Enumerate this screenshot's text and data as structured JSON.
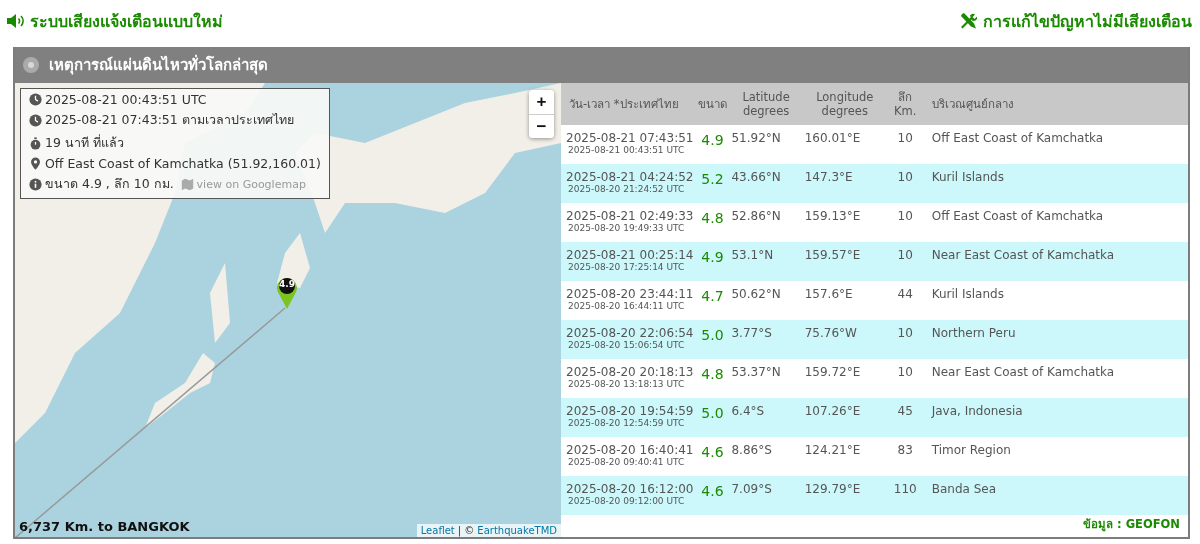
{
  "header": {
    "sound_link": "ระบบเสียงแจ้งเตือนแบบใหม่",
    "help_link": "การแก้ไขปัญหาไม่มีเสียงเตือน"
  },
  "panel": {
    "title": "เหตุการณ์แผ่นดินไหวทั่วโลกล่าสุด"
  },
  "map": {
    "info": [
      {
        "kind": "clock",
        "text": "2025-08-21 00:43:51 UTC"
      },
      {
        "kind": "clock",
        "text": "2025-08-21 07:43:51 ตามเวลาประเทศไทย"
      },
      {
        "kind": "stopwatch",
        "text": "19 นาที ที่แล้ว"
      },
      {
        "kind": "pin",
        "text": "Off East Coast of Kamchatka (51.92,160.01)"
      },
      {
        "kind": "info",
        "text": "ขนาด 4.9 , ลึก 10 กม.",
        "link": "view on Googlemap"
      }
    ],
    "zoom_in": "+",
    "zoom_out": "−",
    "marker": "4.9",
    "distance": "6,737 Km. to BANGKOK",
    "attribution": {
      "leaflet": "Leaflet",
      "separator": "| ©",
      "source": "EarthquakeTMD"
    }
  },
  "table": {
    "columns": [
      "วัน-เวลา *ประเทศไทย",
      "ขนาด",
      "Latitude\ndegrees",
      "Longitude\ndegrees",
      "ลึก\nKm.",
      "บริเวณศูนย์กลาง"
    ],
    "rows": [
      {
        "local": "2025-08-21 07:43:51",
        "utc": "2025-08-21 00:43:51 UTC",
        "mag": "4.9",
        "lat": "51.92°N",
        "lon": "160.01°E",
        "depth": "10",
        "region": "Off East Coast of Kamchatka"
      },
      {
        "local": "2025-08-21 04:24:52",
        "utc": "2025-08-20 21:24:52 UTC",
        "mag": "5.2",
        "lat": "43.66°N",
        "lon": "147.3°E",
        "depth": "10",
        "region": "Kuril Islands"
      },
      {
        "local": "2025-08-21 02:49:33",
        "utc": "2025-08-20 19:49:33 UTC",
        "mag": "4.8",
        "lat": "52.86°N",
        "lon": "159.13°E",
        "depth": "10",
        "region": "Off East Coast of Kamchatka"
      },
      {
        "local": "2025-08-21 00:25:14",
        "utc": "2025-08-20 17:25:14 UTC",
        "mag": "4.9",
        "lat": "53.1°N",
        "lon": "159.57°E",
        "depth": "10",
        "region": "Near East Coast of Kamchatka"
      },
      {
        "local": "2025-08-20 23:44:11",
        "utc": "2025-08-20 16:44:11 UTC",
        "mag": "4.7",
        "lat": "50.62°N",
        "lon": "157.6°E",
        "depth": "44",
        "region": "Kuril Islands"
      },
      {
        "local": "2025-08-20 22:06:54",
        "utc": "2025-08-20 15:06:54 UTC",
        "mag": "5.0",
        "lat": "3.77°S",
        "lon": "75.76°W",
        "depth": "10",
        "region": "Northern Peru"
      },
      {
        "local": "2025-08-20 20:18:13",
        "utc": "2025-08-20 13:18:13 UTC",
        "mag": "4.8",
        "lat": "53.37°N",
        "lon": "159.72°E",
        "depth": "10",
        "region": "Near East Coast of Kamchatka"
      },
      {
        "local": "2025-08-20 19:54:59",
        "utc": "2025-08-20 12:54:59 UTC",
        "mag": "5.0",
        "lat": "6.4°S",
        "lon": "107.26°E",
        "depth": "45",
        "region": "Java, Indonesia"
      },
      {
        "local": "2025-08-20 16:40:41",
        "utc": "2025-08-20 09:40:41 UTC",
        "mag": "4.6",
        "lat": "8.86°S",
        "lon": "124.21°E",
        "depth": "83",
        "region": "Timor Region"
      },
      {
        "local": "2025-08-20 16:12:00",
        "utc": "2025-08-20 09:12:00 UTC",
        "mag": "4.6",
        "lat": "7.09°S",
        "lon": "129.79°E",
        "depth": "110",
        "region": "Banda Sea"
      }
    ]
  },
  "source_note": "ข้อมูล : GEOFON"
}
